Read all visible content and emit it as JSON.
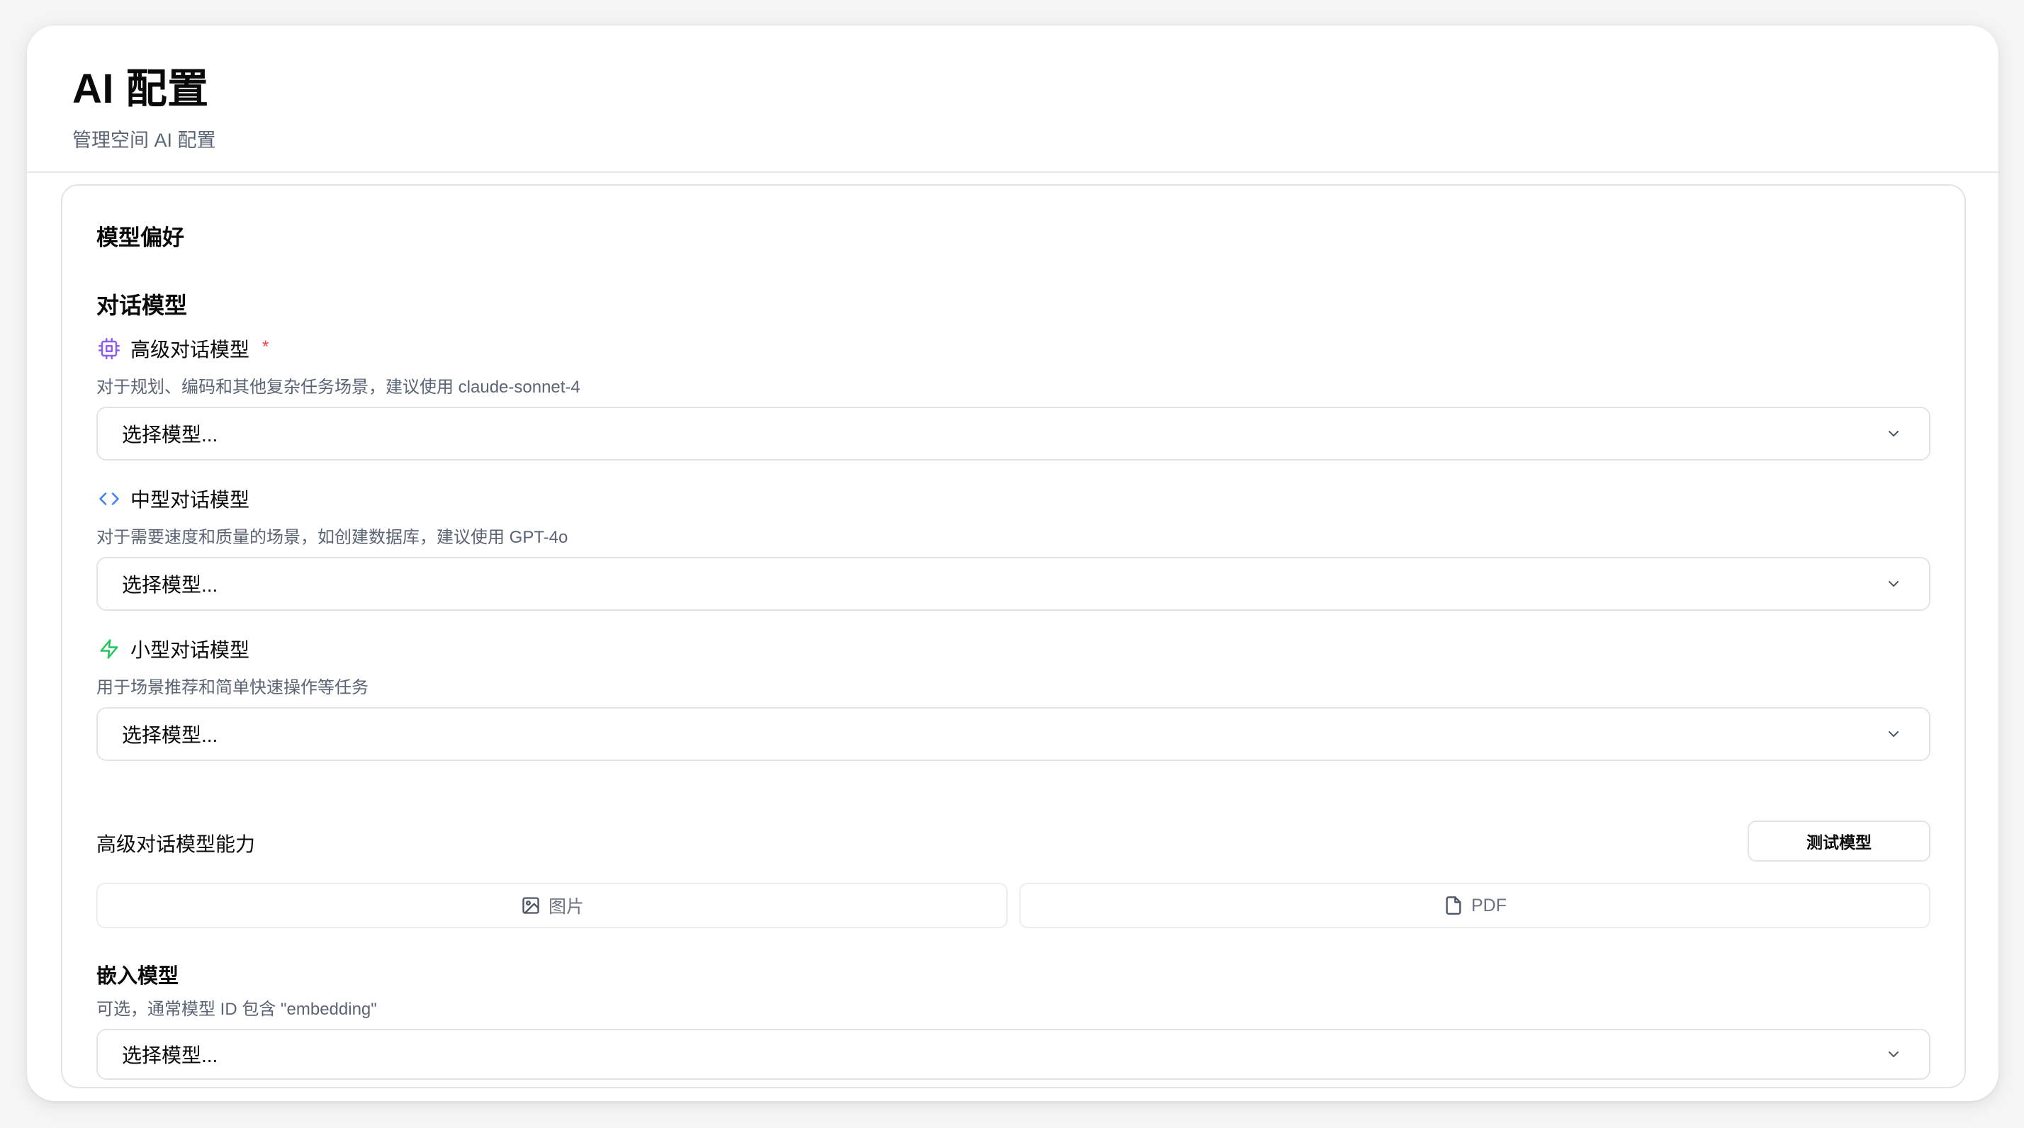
{
  "header": {
    "title": "AI 配置",
    "subtitle": "管理空间 AI 配置"
  },
  "card": {
    "section_title": "模型偏好",
    "chat_group_title": "对话模型",
    "advanced": {
      "label": "高级对话模型",
      "required_mark": "*",
      "description": "对于规划、编码和其他复杂任务场景，建议使用 claude-sonnet-4",
      "select_value": "选择模型...",
      "icon": "cpu-icon",
      "icon_color": "#8b5cf6"
    },
    "medium": {
      "label": "中型对话模型",
      "description": "对于需要速度和质量的场景，如创建数据库，建议使用 GPT-4o",
      "select_value": "选择模型...",
      "icon": "code-icon",
      "icon_color": "#3b82f6"
    },
    "small": {
      "label": "小型对话模型",
      "description": "用于场景推荐和简单快速操作等任务",
      "select_value": "选择模型...",
      "icon": "zap-icon",
      "icon_color": "#22c55e"
    },
    "capabilities": {
      "label": "高级对话模型能力",
      "test_button": "测试模型",
      "items": [
        {
          "label": "图片",
          "icon": "image-icon"
        },
        {
          "label": "PDF",
          "icon": "file-icon"
        }
      ]
    },
    "embedding": {
      "title": "嵌入模型",
      "description": "可选，通常模型 ID 包含 \"embedding\"",
      "select_value": "选择模型..."
    }
  }
}
